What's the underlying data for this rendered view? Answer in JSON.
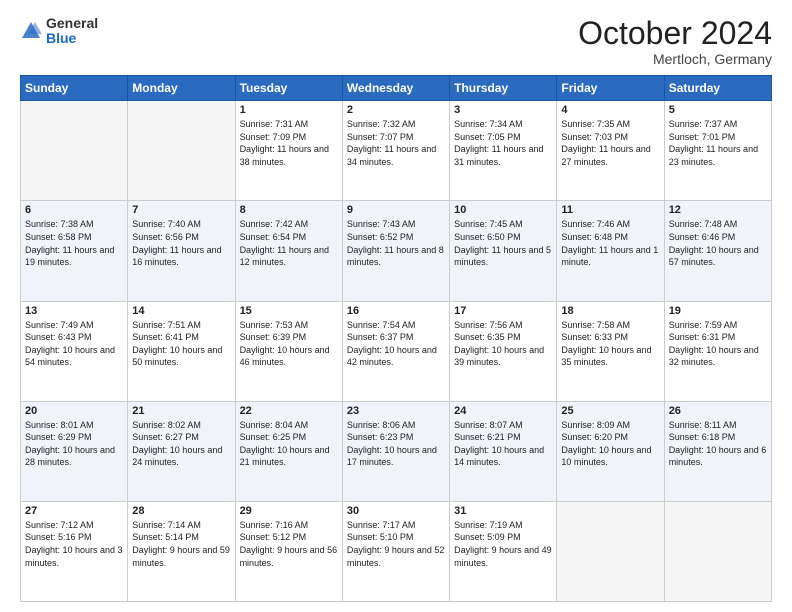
{
  "header": {
    "logo_general": "General",
    "logo_blue": "Blue",
    "month_title": "October 2024",
    "location": "Mertloch, Germany"
  },
  "days_of_week": [
    "Sunday",
    "Monday",
    "Tuesday",
    "Wednesday",
    "Thursday",
    "Friday",
    "Saturday"
  ],
  "weeks": [
    [
      {
        "day": "",
        "empty": true
      },
      {
        "day": "",
        "empty": true
      },
      {
        "day": "1",
        "sunrise": "Sunrise: 7:31 AM",
        "sunset": "Sunset: 7:09 PM",
        "daylight": "Daylight: 11 hours and 38 minutes."
      },
      {
        "day": "2",
        "sunrise": "Sunrise: 7:32 AM",
        "sunset": "Sunset: 7:07 PM",
        "daylight": "Daylight: 11 hours and 34 minutes."
      },
      {
        "day": "3",
        "sunrise": "Sunrise: 7:34 AM",
        "sunset": "Sunset: 7:05 PM",
        "daylight": "Daylight: 11 hours and 31 minutes."
      },
      {
        "day": "4",
        "sunrise": "Sunrise: 7:35 AM",
        "sunset": "Sunset: 7:03 PM",
        "daylight": "Daylight: 11 hours and 27 minutes."
      },
      {
        "day": "5",
        "sunrise": "Sunrise: 7:37 AM",
        "sunset": "Sunset: 7:01 PM",
        "daylight": "Daylight: 11 hours and 23 minutes."
      }
    ],
    [
      {
        "day": "6",
        "sunrise": "Sunrise: 7:38 AM",
        "sunset": "Sunset: 6:58 PM",
        "daylight": "Daylight: 11 hours and 19 minutes."
      },
      {
        "day": "7",
        "sunrise": "Sunrise: 7:40 AM",
        "sunset": "Sunset: 6:56 PM",
        "daylight": "Daylight: 11 hours and 16 minutes."
      },
      {
        "day": "8",
        "sunrise": "Sunrise: 7:42 AM",
        "sunset": "Sunset: 6:54 PM",
        "daylight": "Daylight: 11 hours and 12 minutes."
      },
      {
        "day": "9",
        "sunrise": "Sunrise: 7:43 AM",
        "sunset": "Sunset: 6:52 PM",
        "daylight": "Daylight: 11 hours and 8 minutes."
      },
      {
        "day": "10",
        "sunrise": "Sunrise: 7:45 AM",
        "sunset": "Sunset: 6:50 PM",
        "daylight": "Daylight: 11 hours and 5 minutes."
      },
      {
        "day": "11",
        "sunrise": "Sunrise: 7:46 AM",
        "sunset": "Sunset: 6:48 PM",
        "daylight": "Daylight: 11 hours and 1 minute."
      },
      {
        "day": "12",
        "sunrise": "Sunrise: 7:48 AM",
        "sunset": "Sunset: 6:46 PM",
        "daylight": "Daylight: 10 hours and 57 minutes."
      }
    ],
    [
      {
        "day": "13",
        "sunrise": "Sunrise: 7:49 AM",
        "sunset": "Sunset: 6:43 PM",
        "daylight": "Daylight: 10 hours and 54 minutes."
      },
      {
        "day": "14",
        "sunrise": "Sunrise: 7:51 AM",
        "sunset": "Sunset: 6:41 PM",
        "daylight": "Daylight: 10 hours and 50 minutes."
      },
      {
        "day": "15",
        "sunrise": "Sunrise: 7:53 AM",
        "sunset": "Sunset: 6:39 PM",
        "daylight": "Daylight: 10 hours and 46 minutes."
      },
      {
        "day": "16",
        "sunrise": "Sunrise: 7:54 AM",
        "sunset": "Sunset: 6:37 PM",
        "daylight": "Daylight: 10 hours and 42 minutes."
      },
      {
        "day": "17",
        "sunrise": "Sunrise: 7:56 AM",
        "sunset": "Sunset: 6:35 PM",
        "daylight": "Daylight: 10 hours and 39 minutes."
      },
      {
        "day": "18",
        "sunrise": "Sunrise: 7:58 AM",
        "sunset": "Sunset: 6:33 PM",
        "daylight": "Daylight: 10 hours and 35 minutes."
      },
      {
        "day": "19",
        "sunrise": "Sunrise: 7:59 AM",
        "sunset": "Sunset: 6:31 PM",
        "daylight": "Daylight: 10 hours and 32 minutes."
      }
    ],
    [
      {
        "day": "20",
        "sunrise": "Sunrise: 8:01 AM",
        "sunset": "Sunset: 6:29 PM",
        "daylight": "Daylight: 10 hours and 28 minutes."
      },
      {
        "day": "21",
        "sunrise": "Sunrise: 8:02 AM",
        "sunset": "Sunset: 6:27 PM",
        "daylight": "Daylight: 10 hours and 24 minutes."
      },
      {
        "day": "22",
        "sunrise": "Sunrise: 8:04 AM",
        "sunset": "Sunset: 6:25 PM",
        "daylight": "Daylight: 10 hours and 21 minutes."
      },
      {
        "day": "23",
        "sunrise": "Sunrise: 8:06 AM",
        "sunset": "Sunset: 6:23 PM",
        "daylight": "Daylight: 10 hours and 17 minutes."
      },
      {
        "day": "24",
        "sunrise": "Sunrise: 8:07 AM",
        "sunset": "Sunset: 6:21 PM",
        "daylight": "Daylight: 10 hours and 14 minutes."
      },
      {
        "day": "25",
        "sunrise": "Sunrise: 8:09 AM",
        "sunset": "Sunset: 6:20 PM",
        "daylight": "Daylight: 10 hours and 10 minutes."
      },
      {
        "day": "26",
        "sunrise": "Sunrise: 8:11 AM",
        "sunset": "Sunset: 6:18 PM",
        "daylight": "Daylight: 10 hours and 6 minutes."
      }
    ],
    [
      {
        "day": "27",
        "sunrise": "Sunrise: 7:12 AM",
        "sunset": "Sunset: 5:16 PM",
        "daylight": "Daylight: 10 hours and 3 minutes."
      },
      {
        "day": "28",
        "sunrise": "Sunrise: 7:14 AM",
        "sunset": "Sunset: 5:14 PM",
        "daylight": "Daylight: 9 hours and 59 minutes."
      },
      {
        "day": "29",
        "sunrise": "Sunrise: 7:16 AM",
        "sunset": "Sunset: 5:12 PM",
        "daylight": "Daylight: 9 hours and 56 minutes."
      },
      {
        "day": "30",
        "sunrise": "Sunrise: 7:17 AM",
        "sunset": "Sunset: 5:10 PM",
        "daylight": "Daylight: 9 hours and 52 minutes."
      },
      {
        "day": "31",
        "sunrise": "Sunrise: 7:19 AM",
        "sunset": "Sunset: 5:09 PM",
        "daylight": "Daylight: 9 hours and 49 minutes."
      },
      {
        "day": "",
        "empty": true
      },
      {
        "day": "",
        "empty": true
      }
    ]
  ]
}
